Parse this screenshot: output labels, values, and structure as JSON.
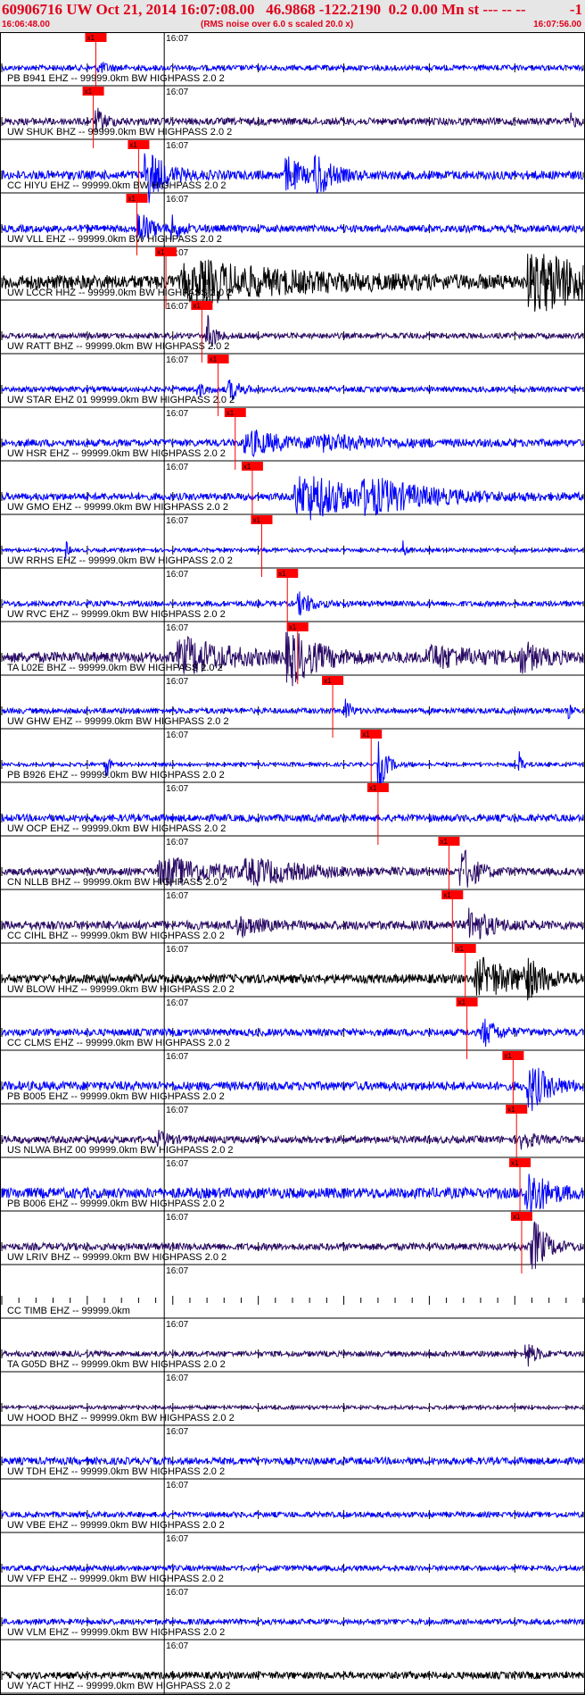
{
  "header": {
    "title": "60906716 UW Oct 21, 2014 16:07:08.00   46.9868 -122.2190  0.2 0.00 Mn st --- -- --",
    "title_end": "-1",
    "start_time": "16:06:48.00",
    "rms_note": "(RMS noise over 6.0 s scaled 20.0 x)",
    "end_time": "16:07:56.00"
  },
  "colors": {
    "header_bg": "#e6e6e6",
    "header_text": "#e0001a",
    "pick_box": "#ff0000",
    "blue": "#0000ff",
    "navy": "#2a0a66",
    "black": "#000000"
  },
  "chart_data": {
    "type": "seismogram",
    "x_unit": "s",
    "time_range": [
      "16:06:48.00",
      "16:07:56.00"
    ],
    "minute_label": "16:07",
    "pick_label": "x1",
    "traces": [
      {
        "label": "PB B941 EHZ -- 99999.0km BW  HIGHPASS  2.0  2",
        "color": "blue",
        "pick_time": 11.0,
        "amp": 3,
        "events": [
          [
            11.5,
            5,
            1.2
          ]
        ]
      },
      {
        "label": "UW SHUK BHZ -- 99999.0km BW  HIGHPASS  2.0  2",
        "color": "navy",
        "pick_time": 10.7,
        "amp": 4,
        "events": [
          [
            11.2,
            12,
            1.0
          ],
          [
            66.5,
            7,
            0.6
          ]
        ]
      },
      {
        "label": "CC HIYU EHZ -- 99999.0km BW  HIGHPASS  2.0  2",
        "color": "blue",
        "pick_time": 16.0,
        "amp": 5,
        "events": [
          [
            17.2,
            28,
            1.8
          ],
          [
            33.5,
            20,
            1.5
          ],
          [
            37.0,
            22,
            1.5
          ]
        ]
      },
      {
        "label": "UW VLL EHZ -- 99999.0km BW  HIGHPASS  2.0  2",
        "color": "blue",
        "pick_time": 15.8,
        "amp": 4,
        "events": [
          [
            16.2,
            20,
            1.2
          ],
          [
            20.0,
            12,
            1.0
          ]
        ]
      },
      {
        "label": "UW LCCR HHZ -- 99999.0km BW  HIGHPASS  2.0  2",
        "color": "black",
        "pick_time": 19.2,
        "amp": 8,
        "events": [
          [
            24.0,
            18,
            10.0
          ],
          [
            63.0,
            36,
            5.0
          ]
        ]
      },
      {
        "label": "UW RATT BHZ -- 99999.0km BW  HIGHPASS  2.0  2",
        "color": "navy",
        "pick_time": 23.4,
        "amp": 3,
        "events": [
          [
            24.0,
            24,
            0.8
          ]
        ]
      },
      {
        "label": "UW STAR EHZ 01 99999.0km BW  HIGHPASS  2.0  2",
        "color": "blue",
        "pick_time": 25.3,
        "amp": 3,
        "events": [
          [
            26.8,
            12,
            1.0
          ],
          [
            23.0,
            6,
            1.0
          ]
        ]
      },
      {
        "label": "UW HSR EHZ -- 99999.0km BW  HIGHPASS  2.0  2",
        "color": "blue",
        "pick_time": 27.3,
        "amp": 4,
        "events": [
          [
            29.5,
            12,
            4.0
          ],
          [
            38.0,
            6,
            7.0
          ]
        ]
      },
      {
        "label": "UW GMO EHZ -- 99999.0km BW  HIGHPASS  2.0  2",
        "color": "blue",
        "pick_time": 29.3,
        "amp": 4,
        "events": [
          [
            36.0,
            24,
            6.0
          ],
          [
            44.0,
            12,
            7.0
          ]
        ]
      },
      {
        "label": "UW RRHS EHZ -- 99999.0km BW  HIGHPASS  2.0  2",
        "color": "blue",
        "pick_time": 30.4,
        "amp": 2,
        "events": [
          [
            7.5,
            10,
            0.3
          ],
          [
            47.0,
            12,
            0.3
          ]
        ]
      },
      {
        "label": "UW RVC EHZ -- 99999.0km BW  HIGHPASS  2.0  2",
        "color": "blue",
        "pick_time": 33.4,
        "amp": 3,
        "events": [
          [
            35.0,
            12,
            1.5
          ]
        ]
      },
      {
        "label": "TA L02E BHZ -- 99999.0km BW  HIGHPASS  2.0  2",
        "color": "navy",
        "pick_time": 34.6,
        "amp": 6,
        "events": [
          [
            22.0,
            18,
            5.0
          ],
          [
            34.0,
            26,
            3.0
          ],
          [
            51.0,
            10,
            5.0
          ],
          [
            61.0,
            14,
            2.0
          ]
        ]
      },
      {
        "label": "UW GHW EHZ -- 99999.0km BW  HIGHPASS  2.0  2",
        "color": "blue",
        "pick_time": 38.7,
        "amp": 3,
        "events": [
          [
            40.3,
            14,
            0.5
          ],
          [
            66.3,
            8,
            0.3
          ]
        ]
      },
      {
        "label": "PB B926 EHZ -- 99999.0km BW  HIGHPASS  2.0  2",
        "color": "blue",
        "pick_time": 43.2,
        "amp": 2,
        "events": [
          [
            12.2,
            22,
            0.3
          ],
          [
            44.2,
            30,
            0.8
          ],
          [
            60.5,
            14,
            0.4
          ]
        ]
      },
      {
        "label": "UW OCP EHZ -- 99999.0km BW  HIGHPASS  2.0  2",
        "color": "blue",
        "pick_time": 44.0,
        "amp": 4,
        "events": []
      },
      {
        "label": "CN NLLB BHZ -- 99999.0km BW  HIGHPASS  2.0  2",
        "color": "navy",
        "pick_time": 52.3,
        "amp": 4,
        "events": [
          [
            20.0,
            14,
            6.0
          ],
          [
            30.0,
            10,
            6.0
          ],
          [
            54.0,
            24,
            1.5
          ]
        ]
      },
      {
        "label": "CC CIHL BHZ -- 99999.0km BW  HIGHPASS  2.0  2",
        "color": "navy",
        "pick_time": 52.7,
        "amp": 5,
        "events": [
          [
            55.0,
            18,
            2.0
          ],
          [
            28.0,
            10,
            2.0
          ]
        ]
      },
      {
        "label": "UW BLOW HHZ -- 99999.0km BW  HIGHPASS  2.0  2",
        "color": "black",
        "pick_time": 54.2,
        "amp": 5,
        "events": [
          [
            56.5,
            20,
            4.0
          ],
          [
            61.5,
            16,
            2.0
          ]
        ]
      },
      {
        "label": "CC CLMS EHZ -- 99999.0km BW  HIGHPASS  2.0  2",
        "color": "blue",
        "pick_time": 54.4,
        "amp": 4,
        "events": [
          [
            56.5,
            14,
            1.5
          ]
        ]
      },
      {
        "label": "PB B005 EHZ -- 99999.0km BW  HIGHPASS  2.0  2",
        "color": "blue",
        "pick_time": 59.8,
        "amp": 5,
        "events": [
          [
            62.0,
            24,
            2.0
          ]
        ]
      },
      {
        "label": "US NLWA BHZ 00 99999.0km BW  HIGHPASS  2.0  2",
        "color": "navy",
        "pick_time": 60.2,
        "amp": 4,
        "events": [
          [
            18.5,
            8,
            1.0
          ],
          [
            61.0,
            12,
            1.0
          ]
        ]
      },
      {
        "label": "PB B006 EHZ -- 99999.0km BW  HIGHPASS  2.0  2",
        "color": "blue",
        "pick_time": 60.6,
        "amp": 6,
        "events": [
          [
            61.8,
            26,
            2.0
          ]
        ]
      },
      {
        "label": "UW LRIV BHZ -- 99999.0km BW  HIGHPASS  2.0  2",
        "color": "navy",
        "pick_time": 60.8,
        "amp": 4,
        "events": [
          [
            62.3,
            28,
            1.5
          ]
        ]
      },
      {
        "label": "CC TIMB EHZ -- 99999.0km",
        "color": "blue",
        "pick_time": null,
        "amp": 0,
        "events": []
      },
      {
        "label": "TA G05D BHZ -- 99999.0km BW  HIGHPASS  2.0  2",
        "color": "navy",
        "pick_time": null,
        "amp": 3,
        "events": [
          [
            61.5,
            14,
            1.0
          ]
        ]
      },
      {
        "label": "UW HOOD BHZ -- 99999.0km BW  HIGHPASS  2.0  2",
        "color": "navy",
        "pick_time": null,
        "amp": 2,
        "events": []
      },
      {
        "label": "UW TDH EHZ -- 99999.0km BW  HIGHPASS  2.0  2",
        "color": "blue",
        "pick_time": null,
        "amp": 4,
        "events": []
      },
      {
        "label": "UW VBE EHZ -- 99999.0km BW  HIGHPASS  2.0  2",
        "color": "blue",
        "pick_time": null,
        "amp": 3,
        "events": []
      },
      {
        "label": "UW VFP EHZ -- 99999.0km BW  HIGHPASS  2.0  2",
        "color": "blue",
        "pick_time": null,
        "amp": 3,
        "events": []
      },
      {
        "label": "UW VLM EHZ -- 99999.0km BW  HIGHPASS  2.0  2",
        "color": "blue",
        "pick_time": null,
        "amp": 3,
        "events": []
      },
      {
        "label": "UW YACT HHZ -- 99999.0km BW  HIGHPASS  2.0  2",
        "color": "black",
        "pick_time": null,
        "amp": 4,
        "events": []
      }
    ]
  }
}
